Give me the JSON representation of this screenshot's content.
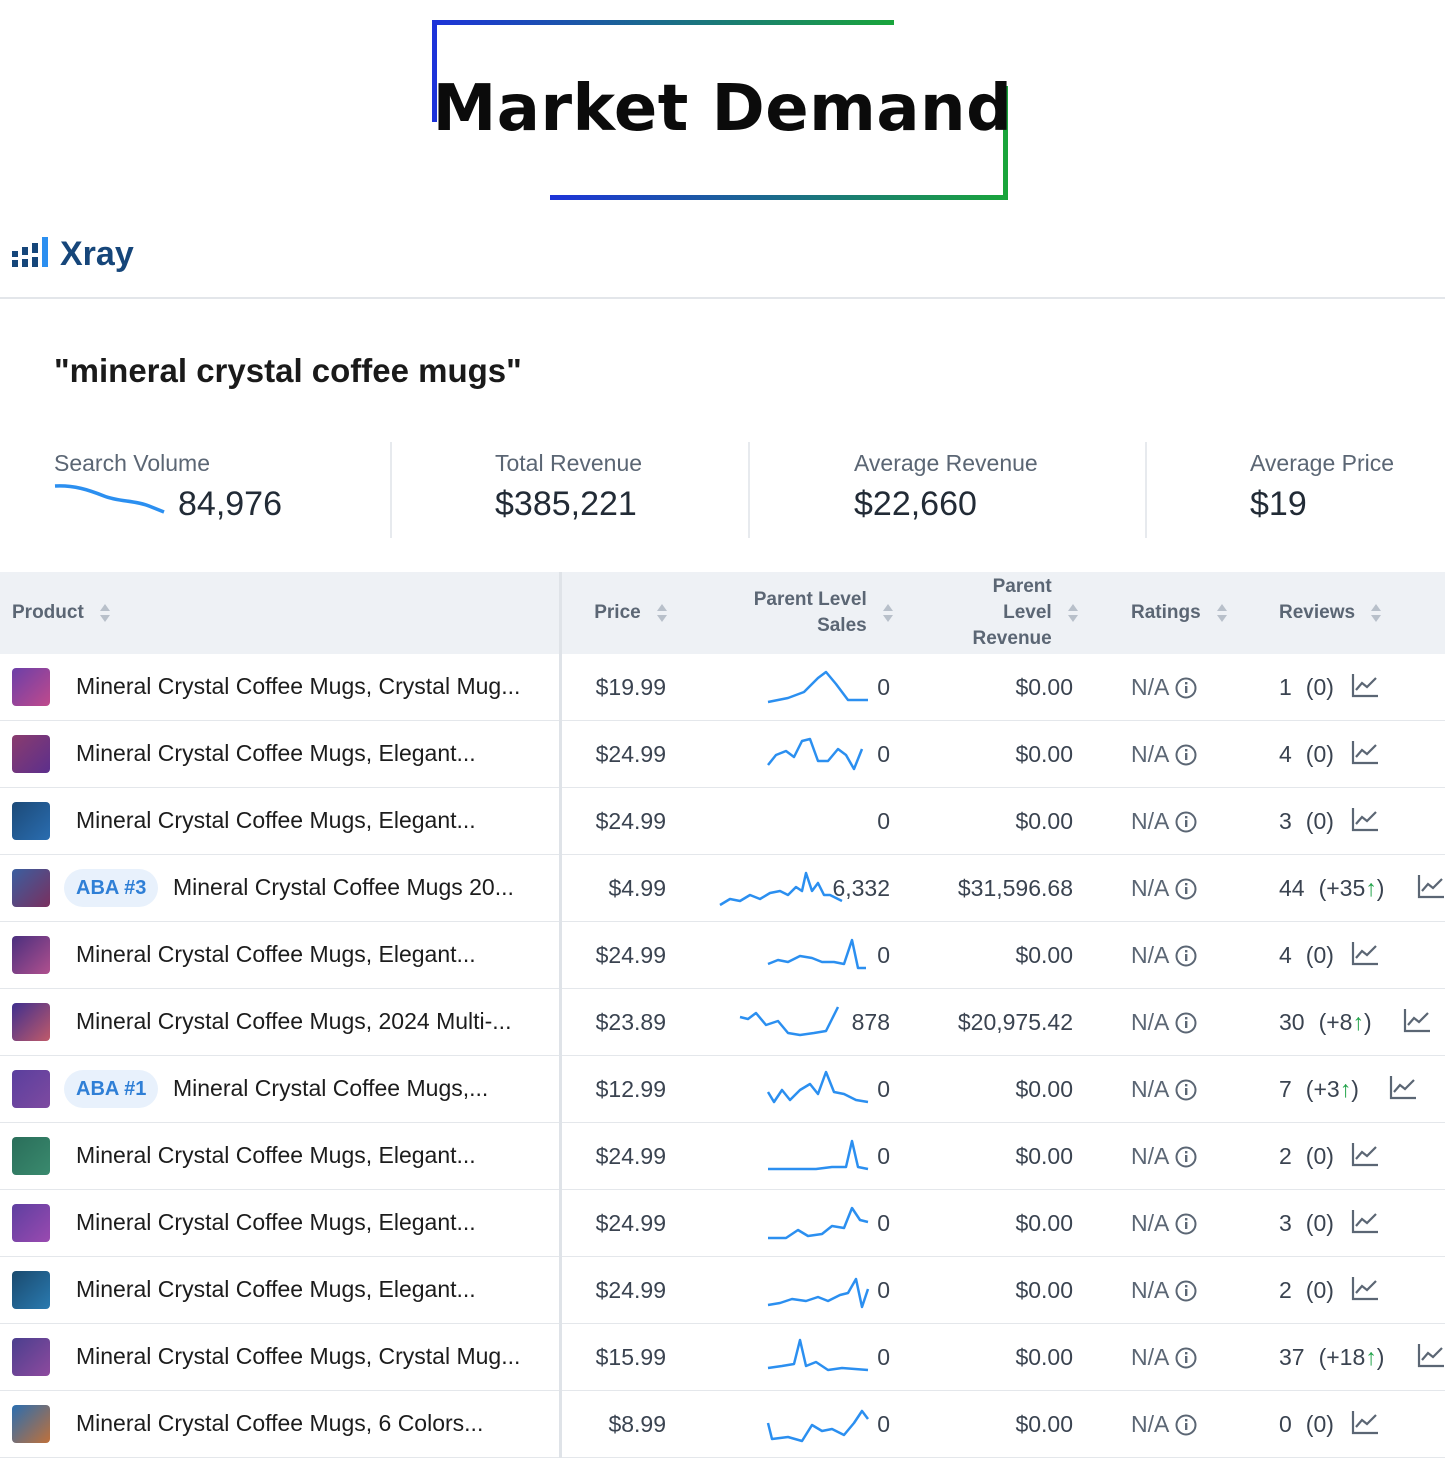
{
  "banner": {
    "title": "Market Demand"
  },
  "app": {
    "name": "Xray"
  },
  "keyword": "\"mineral crystal coffee mugs\"",
  "stats": {
    "search_volume": {
      "label": "Search Volume",
      "value": "84,976"
    },
    "total_revenue": {
      "label": "Total Revenue",
      "value": "$385,221"
    },
    "average_revenue": {
      "label": "Average Revenue",
      "value": "$22,660"
    },
    "average_price": {
      "label": "Average Price",
      "value": "$19"
    }
  },
  "columns": {
    "product": "Product",
    "price": "Price",
    "sales_l1": "Parent Level",
    "sales_l2": "Sales",
    "revenue_l1": "Parent",
    "revenue_l2": "Level",
    "revenue_l3": "Revenue",
    "ratings": "Ratings",
    "reviews": "Reviews"
  },
  "colors": {
    "accent": "#2b8ff0",
    "brand": "#16467a",
    "up": "#22a34a"
  },
  "rows": [
    {
      "name": "Mineral Crystal Coffee Mugs, Crystal Mug...",
      "aba": "",
      "price": "$19.99",
      "sales": "0",
      "revenue": "$0.00",
      "rating": "N/A",
      "reviews": "1",
      "change": "(0)",
      "up": false
    },
    {
      "name": "Mineral Crystal Coffee Mugs, Elegant...",
      "aba": "",
      "price": "$24.99",
      "sales": "0",
      "revenue": "$0.00",
      "rating": "N/A",
      "reviews": "4",
      "change": "(0)",
      "up": false
    },
    {
      "name": "Mineral Crystal Coffee Mugs, Elegant...",
      "aba": "",
      "price": "$24.99",
      "sales": "0",
      "revenue": "$0.00",
      "rating": "N/A",
      "reviews": "3",
      "change": "(0)",
      "up": false
    },
    {
      "name": "Mineral Crystal Coffee Mugs 20...",
      "aba": "ABA #3",
      "price": "$4.99",
      "sales": "6,332",
      "revenue": "$31,596.68",
      "rating": "N/A",
      "reviews": "44",
      "change": "(+35",
      "up": true
    },
    {
      "name": "Mineral Crystal Coffee Mugs, Elegant...",
      "aba": "",
      "price": "$24.99",
      "sales": "0",
      "revenue": "$0.00",
      "rating": "N/A",
      "reviews": "4",
      "change": "(0)",
      "up": false
    },
    {
      "name": "Mineral Crystal Coffee Mugs, 2024 Multi-...",
      "aba": "",
      "price": "$23.89",
      "sales": "878",
      "revenue": "$20,975.42",
      "rating": "N/A",
      "reviews": "30",
      "change": "(+8",
      "up": true
    },
    {
      "name": "Mineral Crystal Coffee Mugs,...",
      "aba": "ABA #1",
      "price": "$12.99",
      "sales": "0",
      "revenue": "$0.00",
      "rating": "N/A",
      "reviews": "7",
      "change": "(+3",
      "up": true
    },
    {
      "name": "Mineral Crystal Coffee Mugs, Elegant...",
      "aba": "",
      "price": "$24.99",
      "sales": "0",
      "revenue": "$0.00",
      "rating": "N/A",
      "reviews": "2",
      "change": "(0)",
      "up": false
    },
    {
      "name": "Mineral Crystal Coffee Mugs, Elegant...",
      "aba": "",
      "price": "$24.99",
      "sales": "0",
      "revenue": "$0.00",
      "rating": "N/A",
      "reviews": "3",
      "change": "(0)",
      "up": false
    },
    {
      "name": "Mineral Crystal Coffee Mugs, Elegant...",
      "aba": "",
      "price": "$24.99",
      "sales": "0",
      "revenue": "$0.00",
      "rating": "N/A",
      "reviews": "2",
      "change": "(0)",
      "up": false
    },
    {
      "name": "Mineral Crystal Coffee Mugs, Crystal Mug...",
      "aba": "",
      "price": "$15.99",
      "sales": "0",
      "revenue": "$0.00",
      "rating": "N/A",
      "reviews": "37",
      "change": "(+18",
      "up": true
    },
    {
      "name": "Mineral Crystal Coffee Mugs, 6 Colors...",
      "aba": "",
      "price": "$8.99",
      "sales": "0",
      "revenue": "$0.00",
      "rating": "N/A",
      "reviews": "0",
      "change": "(0)",
      "up": false
    }
  ]
}
